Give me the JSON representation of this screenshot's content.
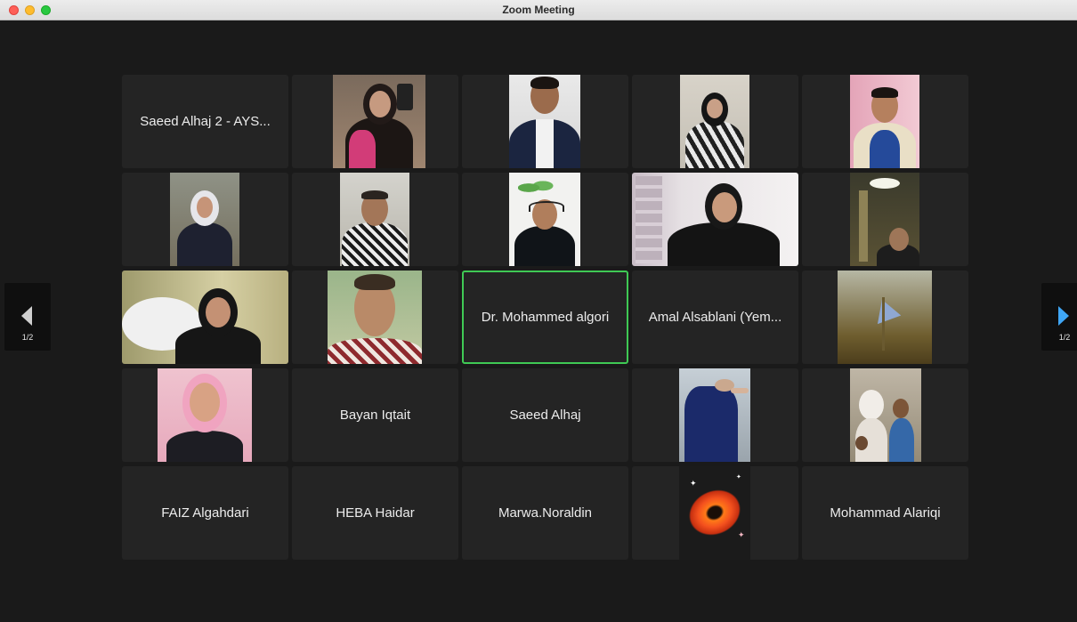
{
  "window": {
    "title": "Zoom Meeting"
  },
  "pagination": {
    "left_label": "1/2",
    "right_label": "1/2"
  },
  "colors": {
    "active_speaker_border": "#3fc954",
    "next_arrow": "#3fa6f5"
  },
  "tiles": [
    {
      "type": "name",
      "label": "Saeed Alhaj 2 - AYS..."
    },
    {
      "type": "video"
    },
    {
      "type": "video"
    },
    {
      "type": "video"
    },
    {
      "type": "video"
    },
    {
      "type": "video"
    },
    {
      "type": "video"
    },
    {
      "type": "video"
    },
    {
      "type": "video"
    },
    {
      "type": "video"
    },
    {
      "type": "video"
    },
    {
      "type": "video"
    },
    {
      "type": "name",
      "label": "Dr. Mohammed algori",
      "active": true
    },
    {
      "type": "name",
      "label": "Amal Alsablani (Yem..."
    },
    {
      "type": "video"
    },
    {
      "type": "video"
    },
    {
      "type": "name",
      "label": "Bayan Iqtait"
    },
    {
      "type": "name",
      "label": "Saeed Alhaj"
    },
    {
      "type": "video"
    },
    {
      "type": "video"
    },
    {
      "type": "name",
      "label": "FAIZ Algahdari"
    },
    {
      "type": "name",
      "label": "HEBA Haidar"
    },
    {
      "type": "name",
      "label": "Marwa.Noraldin"
    },
    {
      "type": "avatar-image"
    },
    {
      "type": "name",
      "label": "Mohammad Alariqi"
    }
  ]
}
